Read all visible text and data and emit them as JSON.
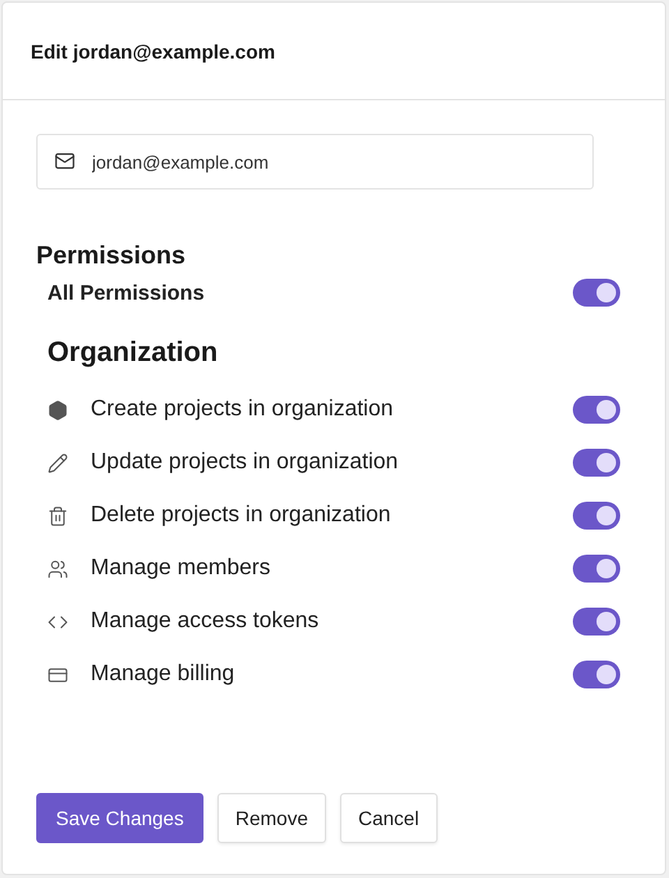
{
  "dialog": {
    "title": "Edit jordan@example.com"
  },
  "email_field": {
    "value": "jordan@example.com"
  },
  "permissions": {
    "heading": "Permissions",
    "all": {
      "label": "All Permissions",
      "on": true
    }
  },
  "organization": {
    "heading": "Organization",
    "items": [
      {
        "label": "Create projects in organization",
        "on": true
      },
      {
        "label": "Update projects in organization",
        "on": true
      },
      {
        "label": "Delete projects in organization",
        "on": true
      },
      {
        "label": "Manage members",
        "on": true
      },
      {
        "label": "Manage access tokens",
        "on": true
      },
      {
        "label": "Manage billing",
        "on": true
      }
    ]
  },
  "buttons": [
    {
      "label": "Save Changes",
      "kind": "primary"
    },
    {
      "label": "Remove",
      "kind": "secondary"
    },
    {
      "label": "Cancel",
      "kind": "secondary"
    }
  ]
}
